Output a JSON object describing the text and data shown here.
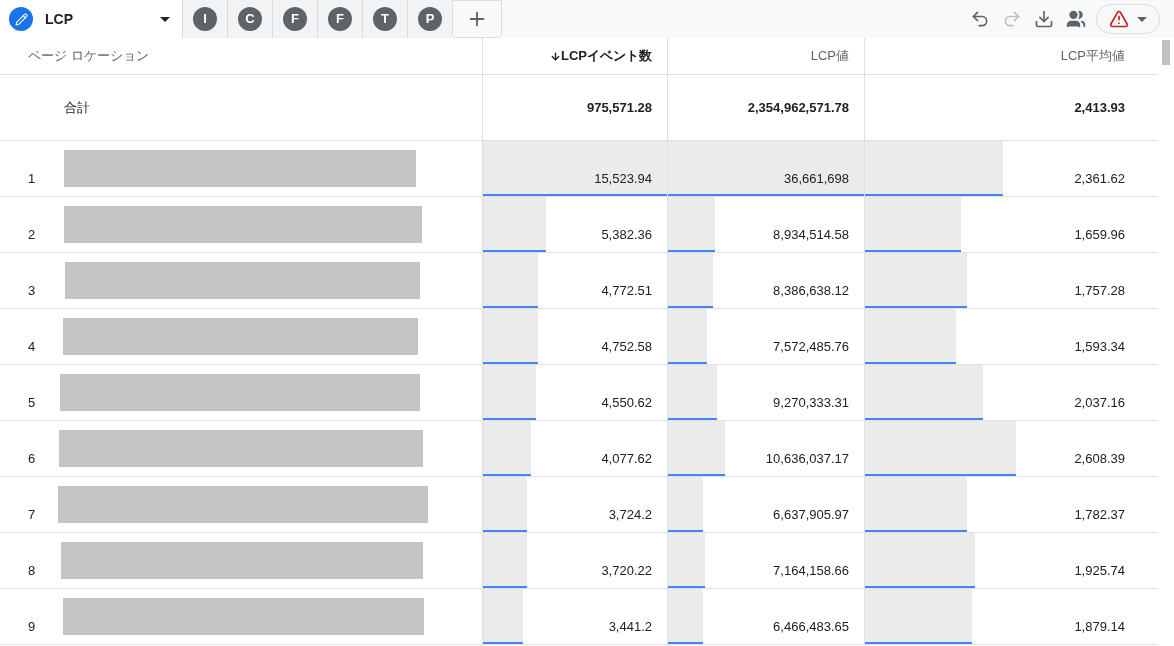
{
  "tabs": [
    {
      "label": "LCP",
      "selected": true
    },
    {
      "label": "I",
      "selected": false
    },
    {
      "label": "C",
      "selected": false
    },
    {
      "label": "F",
      "selected": false
    },
    {
      "label": "F",
      "selected": false
    },
    {
      "label": "T",
      "selected": false
    },
    {
      "label": "P",
      "selected": false
    }
  ],
  "toolbar": [
    {
      "kind": "undo",
      "disabled": false
    },
    {
      "kind": "redo",
      "disabled": true
    },
    {
      "kind": "download",
      "disabled": false
    },
    {
      "kind": "share",
      "disabled": false
    },
    {
      "kind": "warning",
      "disabled": false
    }
  ],
  "table": {
    "columns": [
      {
        "label": "ページ ロケーション",
        "sorted": false
      },
      {
        "label": "LCPイベント数",
        "sorted": true
      },
      {
        "label": "LCP値",
        "sorted": false
      },
      {
        "label": "LCP平均値",
        "sorted": false
      }
    ],
    "total": {
      "label": "合計",
      "values": [
        "975,571.28",
        "2,354,962,571.78",
        "2,413.93"
      ]
    },
    "rows": [
      {
        "cells": [
          {
            "value": "1"
          },
          {
            "value": "15,523.94",
            "level": 1.0
          },
          {
            "value": "36,661,698",
            "level": 1.0
          },
          {
            "value": "2,361.62",
            "level": 0.5
          }
        ]
      },
      {
        "cells": [
          {
            "value": "2"
          },
          {
            "value": "5,382.36",
            "level": 0.34
          },
          {
            "value": "8,934,514.58",
            "level": 0.24
          },
          {
            "value": "1,659.96",
            "level": 0.35
          }
        ]
      },
      {
        "cells": [
          {
            "value": "3"
          },
          {
            "value": "4,772.51",
            "level": 0.3
          },
          {
            "value": "8,386,638.12",
            "level": 0.23
          },
          {
            "value": "1,757.28",
            "level": 0.37
          }
        ]
      },
      {
        "cells": [
          {
            "value": "4"
          },
          {
            "value": "4,752.58",
            "level": 0.3
          },
          {
            "value": "7,572,485.76",
            "level": 0.2
          },
          {
            "value": "1,593.34",
            "level": 0.33
          }
        ]
      },
      {
        "cells": [
          {
            "value": "5"
          },
          {
            "value": "4,550.62",
            "level": 0.29
          },
          {
            "value": "9,270,333.31",
            "level": 0.25
          },
          {
            "value": "2,037.16",
            "level": 0.43
          }
        ]
      },
      {
        "cells": [
          {
            "value": "6"
          },
          {
            "value": "4,077.62",
            "level": 0.26
          },
          {
            "value": "10,636,037.17",
            "level": 0.29
          },
          {
            "value": "2,608.39",
            "level": 0.55
          }
        ]
      },
      {
        "cells": [
          {
            "value": "7"
          },
          {
            "value": "3,724.2",
            "level": 0.24
          },
          {
            "value": "6,637,905.97",
            "level": 0.18
          },
          {
            "value": "1,782.37",
            "level": 0.37
          }
        ]
      },
      {
        "cells": [
          {
            "value": "8"
          },
          {
            "value": "3,720.22",
            "level": 0.24
          },
          {
            "value": "7,164,158.66",
            "level": 0.19
          },
          {
            "value": "1,925.74",
            "level": 0.4
          }
        ]
      },
      {
        "cells": [
          {
            "value": "9"
          },
          {
            "value": "3,441.2",
            "level": 0.22
          },
          {
            "value": "6,466,483.65",
            "level": 0.18
          },
          {
            "value": "1,879.14",
            "level": 0.39
          }
        ]
      }
    ]
  }
}
